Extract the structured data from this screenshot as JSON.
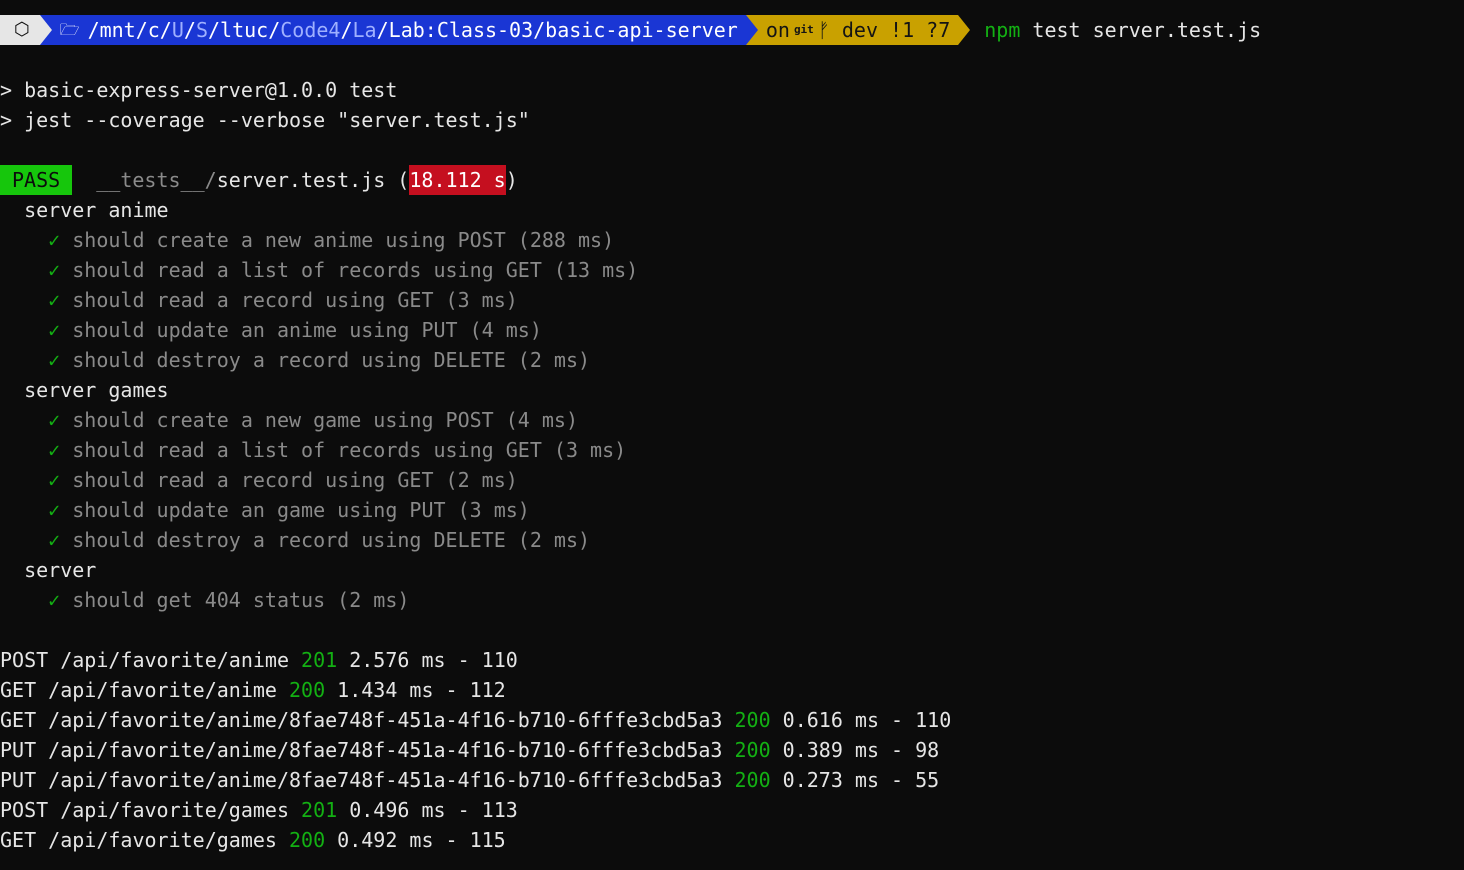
{
  "prompt": {
    "os_icon": "⬡",
    "folder_icon": "🗁",
    "path_parts": [
      "/mnt/c/",
      "U",
      "/",
      "S",
      "/ltuc/",
      "Code4",
      "/",
      "La",
      "/Lab:Class-03/basic-api-server"
    ],
    "git_on": "on",
    "git_icon": "git",
    "branch_icon": "ᚠ",
    "git_branch": "dev !1 ?7",
    "command_prog": "npm",
    "command_args": " test server.test.js"
  },
  "script_lines": [
    "> basic-express-server@1.0.0 test",
    "> jest --coverage --verbose \"server.test.js\""
  ],
  "result": {
    "status": "PASS",
    "file_dir": "__tests__/",
    "file_name": "server.test.js",
    "open_paren": " (",
    "duration": "18.112 s",
    "close_paren": ")"
  },
  "suites": [
    {
      "name": "server anime",
      "tests": [
        "should create a new anime using POST (288 ms)",
        "should read a list of records using GET (13 ms)",
        "should read a record using GET (3 ms)",
        "should update an anime using PUT (4 ms)",
        "should destroy a record using DELETE (2 ms)"
      ]
    },
    {
      "name": "server games",
      "tests": [
        "should create a new game using POST (4 ms)",
        "should read a list of records using GET (3 ms)",
        "should read a record using GET (2 ms)",
        "should update an game using PUT (3 ms)",
        "should destroy a record using DELETE (2 ms)"
      ]
    },
    {
      "name": "server",
      "tests": [
        "should get 404 status (2 ms)"
      ]
    }
  ],
  "check_mark": "✓",
  "logs": [
    {
      "pre": "POST /api/favorite/anime ",
      "status": "201",
      "post": " 2.576 ms - 110"
    },
    {
      "pre": "GET /api/favorite/anime ",
      "status": "200",
      "post": " 1.434 ms - 112"
    },
    {
      "pre": "GET /api/favorite/anime/8fae748f-451a-4f16-b710-6fffe3cbd5a3 ",
      "status": "200",
      "post": " 0.616 ms - 110"
    },
    {
      "pre": "PUT /api/favorite/anime/8fae748f-451a-4f16-b710-6fffe3cbd5a3 ",
      "status": "200",
      "post": " 0.389 ms - 98"
    },
    {
      "pre": "PUT /api/favorite/anime/8fae748f-451a-4f16-b710-6fffe3cbd5a3 ",
      "status": "200",
      "post": " 0.273 ms - 55"
    },
    {
      "pre": "POST /api/favorite/games ",
      "status": "201",
      "post": " 0.496 ms - 113"
    },
    {
      "pre": "GET /api/favorite/games ",
      "status": "200",
      "post": " 0.492 ms - 115"
    }
  ],
  "colors": {
    "background": "#0c0c0c",
    "os_segment": "#e6e6e6",
    "path_segment": "#1a36d4",
    "git_segment": "#c9a100",
    "pass": "#16c60c",
    "duration_badge": "#c50f1f",
    "check": "#13b013",
    "muted": "#8a8a8a"
  }
}
